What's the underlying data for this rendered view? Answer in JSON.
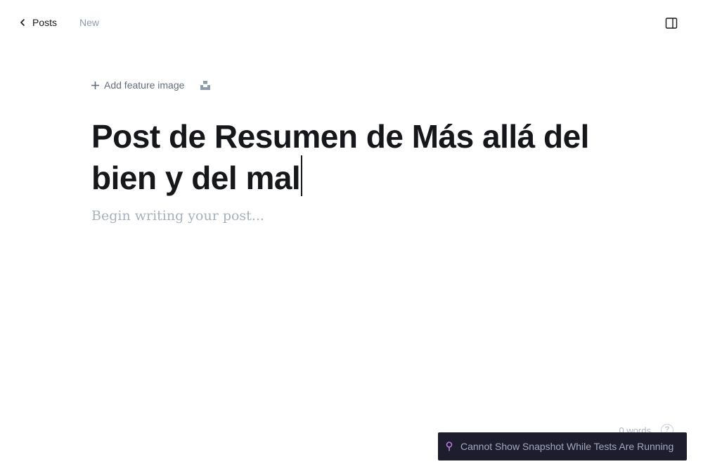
{
  "topbar": {
    "back_label": "Posts",
    "status": "New"
  },
  "editor": {
    "add_feature_label": "Add feature image",
    "title": "Post de Resumen de Más allá del bien y del mal",
    "body_placeholder": "Begin writing your post..."
  },
  "footer": {
    "word_count": "0 words",
    "help_glyph": "?"
  },
  "banner": {
    "message": "Cannot Show Snapshot While Tests Are Running",
    "pin_color": "#b57ae0"
  },
  "icons": {
    "back": "chevron-left-icon",
    "sidebar": "sidebar-toggle-icon",
    "add": "plus-icon",
    "unsplash": "unsplash-icon",
    "help": "help-icon",
    "pin": "pin-icon"
  }
}
